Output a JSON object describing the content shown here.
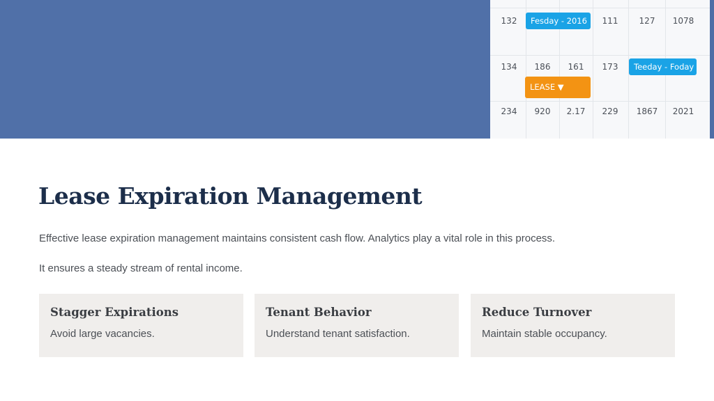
{
  "calendar": {
    "rows": [
      [
        "132",
        "",
        "",
        "111",
        "127",
        "1078"
      ],
      [
        "134",
        "186",
        "161",
        "173",
        "",
        ""
      ],
      [
        "234",
        "920",
        "2.17",
        "229",
        "1867",
        "2021"
      ]
    ],
    "events": {
      "event_1": "Fesday - 2016",
      "event_2": "Teeday - Foday",
      "event_3": "LEASE ▼"
    },
    "colors": {
      "blue": "#1aa3e6",
      "orange": "#f39313",
      "banner": "#5070a8"
    }
  },
  "heading": "Lease Expiration Management",
  "paragraphs": [
    "Effective lease expiration management maintains consistent cash flow. Analytics play a vital role in this process.",
    "It ensures a steady stream of rental income."
  ],
  "cards": [
    {
      "title": "Stagger Expirations",
      "text": "Avoid large vacancies."
    },
    {
      "title": "Tenant Behavior",
      "text": "Understand tenant satisfaction."
    },
    {
      "title": "Reduce Turnover",
      "text": "Maintain stable occupancy."
    }
  ]
}
